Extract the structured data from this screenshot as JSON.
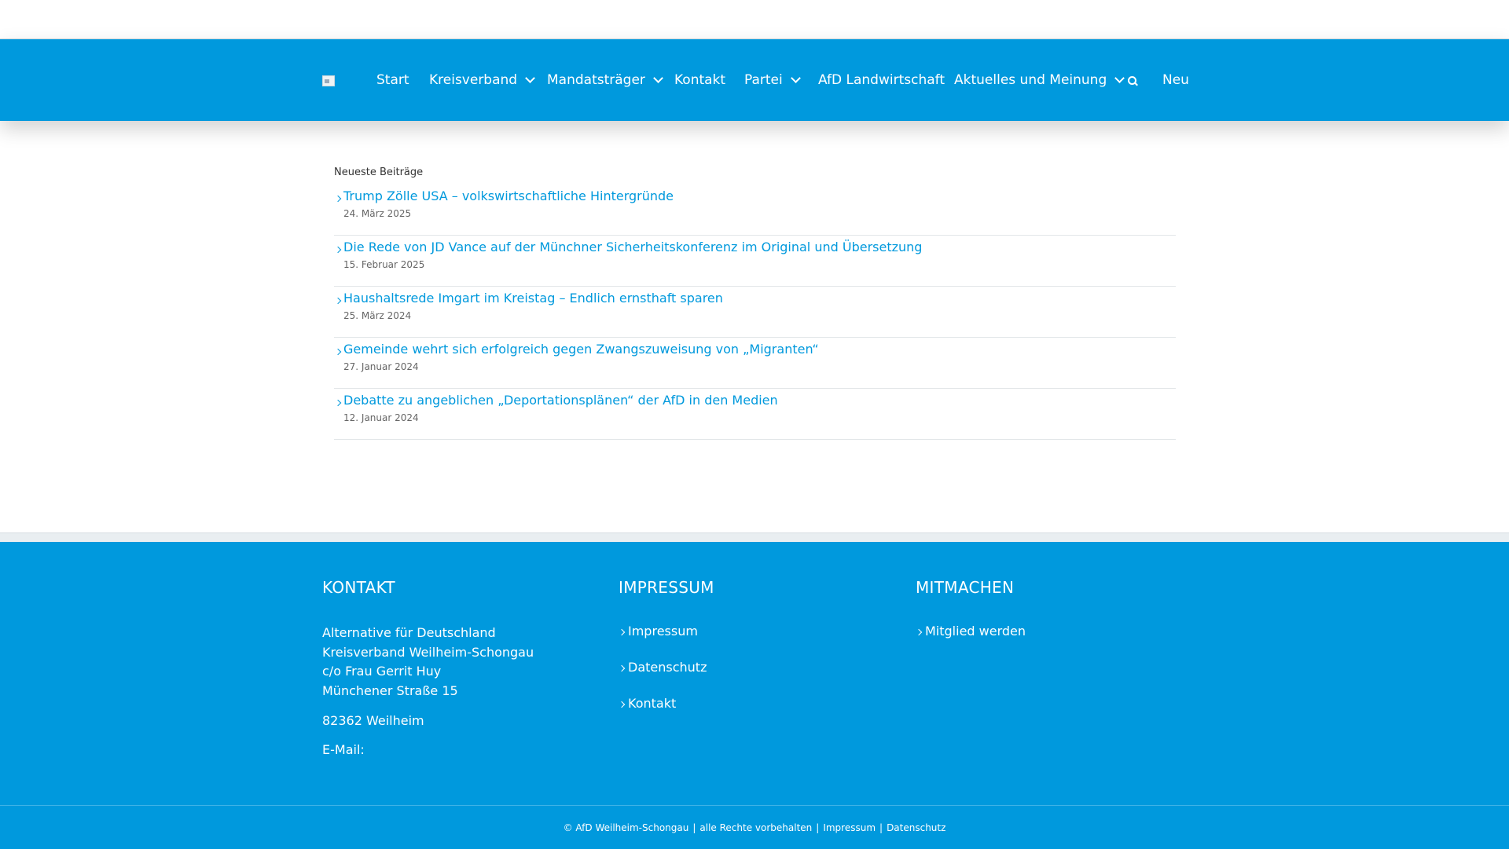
{
  "nav": {
    "items": [
      {
        "label": "Start",
        "has_dropdown": false
      },
      {
        "label": "Kreisverband",
        "has_dropdown": true
      },
      {
        "label": "Mandatsträger",
        "has_dropdown": true
      },
      {
        "label": "Kontakt",
        "has_dropdown": false
      },
      {
        "label": "Partei",
        "has_dropdown": true
      },
      {
        "label": "AfD Landwirtschaft",
        "has_dropdown": false
      },
      {
        "label": "Aktuelles und Meinung",
        "has_dropdown": true
      }
    ],
    "search_icon": "search-icon",
    "new_label": "Neu"
  },
  "recent_posts": {
    "title": "Neueste Beiträge",
    "items": [
      {
        "title": "Trump Zölle USA – volkswirtschaftliche Hintergründe",
        "date": "24. März 2025"
      },
      {
        "title": "Die Rede von JD Vance auf der Münchner Sicherheitskonferenz im Original und Übersetzung",
        "date": "15. Februar 2025"
      },
      {
        "title": "Haushaltsrede Imgart im Kreistag – Endlich ernsthaft sparen",
        "date": "25. März 2024"
      },
      {
        "title": "Gemeinde wehrt sich erfolgreich gegen Zwangszuweisung von „Migranten“",
        "date": "27. Januar 2024"
      },
      {
        "title": "Debatte zu angeblichen „Deportationsplänen“ der AfD in den Medien",
        "date": "12. Januar 2024"
      }
    ]
  },
  "footer": {
    "kontakt": {
      "heading": "KONTAKT",
      "address_lines": [
        "Alternative für Deutschland",
        "Kreisverband Weilheim-Schongau",
        "c/o Frau Gerrit Huy",
        "Münchener Straße 15"
      ],
      "city": "82362 Weilheim",
      "email_label": "E-Mail:"
    },
    "impressum": {
      "heading": "IMPRESSUM",
      "links": [
        "Impressum",
        "Datenschutz",
        "Kontakt"
      ]
    },
    "mitmachen": {
      "heading": "MITMACHEN",
      "links": [
        "Mitglied werden"
      ]
    }
  },
  "copyright": {
    "text": "© AfD Weilheim-Schongau",
    "rights": "alle Rechte vorbehalten",
    "impressum": "Impressum",
    "datenschutz": "Datenschutz"
  },
  "colors": {
    "primary": "#0099dd",
    "text": "#333333"
  }
}
